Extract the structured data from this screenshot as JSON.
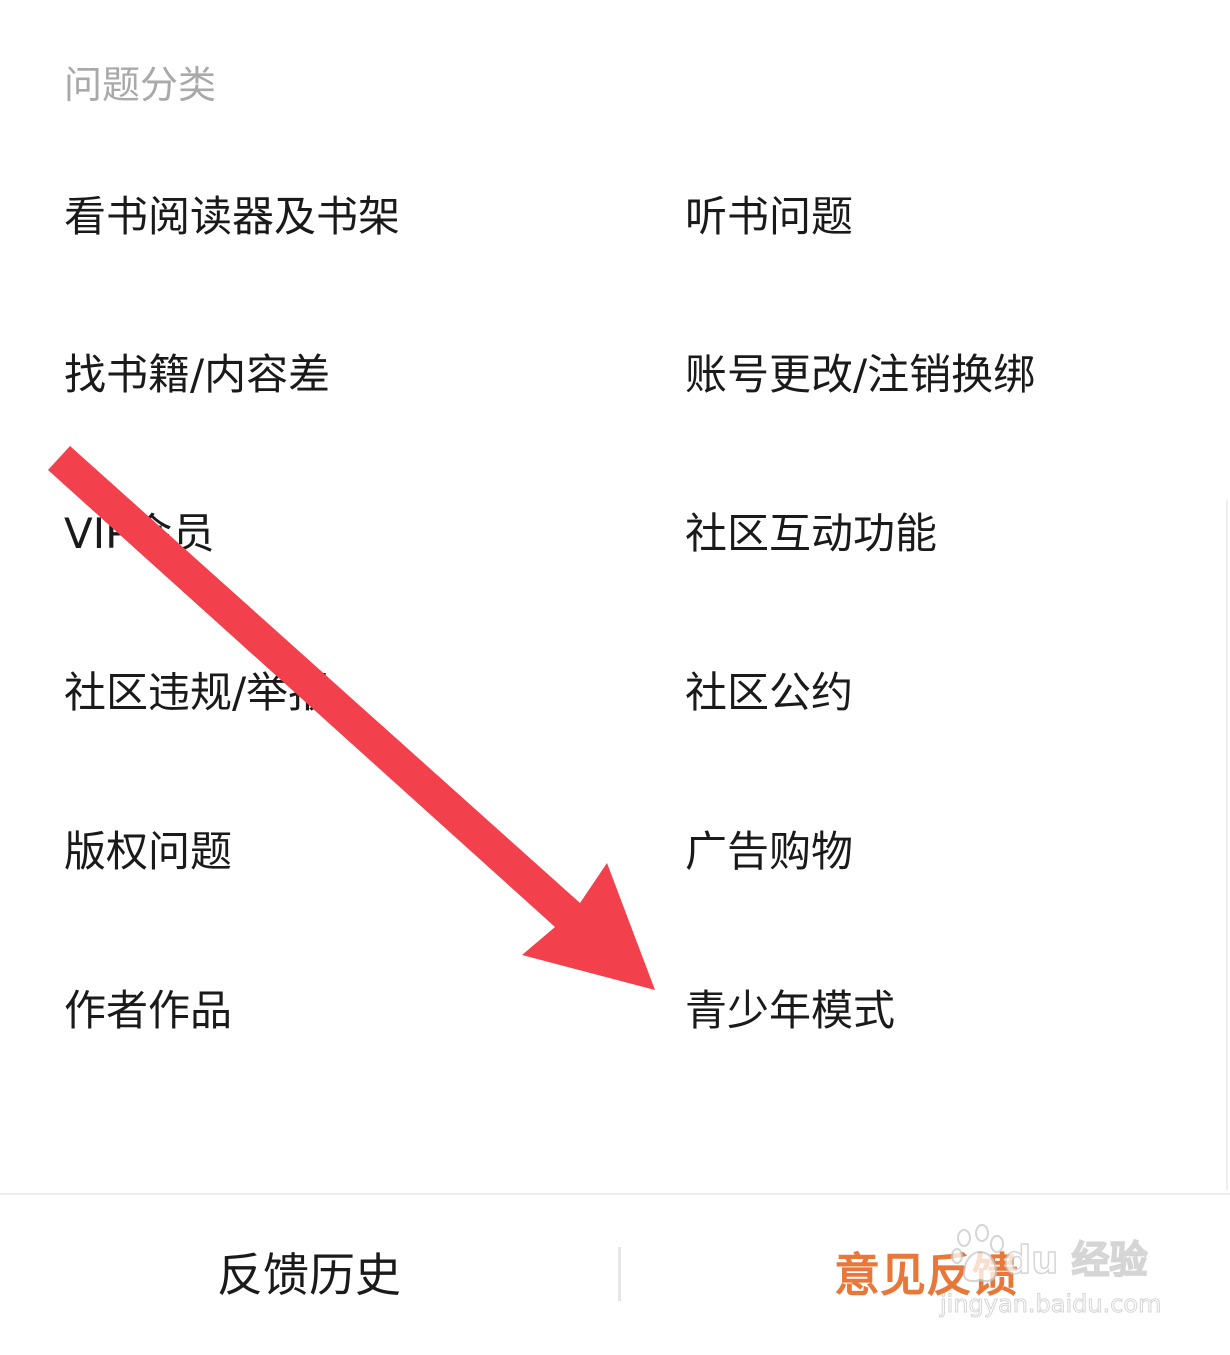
{
  "section": {
    "title": "问题分类"
  },
  "categories": [
    "看书阅读器及书架",
    "听书问题",
    "找书籍/内容差",
    "账号更改/注销换绑",
    "VIP会员",
    "社区互动功能",
    "社区违规/举报",
    "社区公约",
    "版权问题",
    "广告购物",
    "作者作品",
    "青少年模式"
  ],
  "bottom_bar": {
    "history_label": "反馈历史",
    "feedback_label": "意见反馈"
  },
  "overlay": {
    "arrow_color": "#f2404c"
  },
  "watermark": {
    "brand_text": "du 经验",
    "url_text": "jingyan.baidu.com"
  },
  "colors": {
    "accent": "#e8783a",
    "section_title": "#a9a9a9",
    "item_text": "#1a1a1a"
  }
}
